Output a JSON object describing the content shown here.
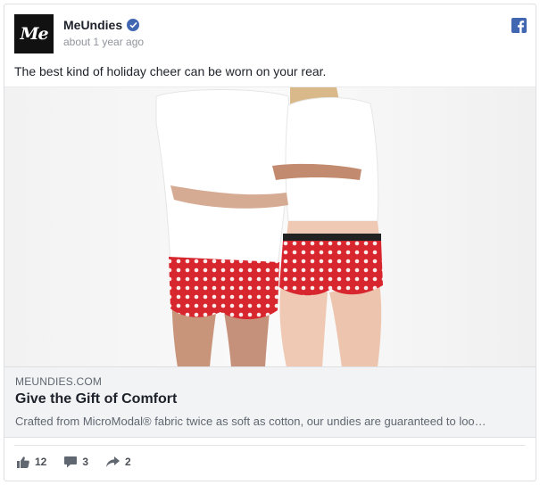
{
  "post": {
    "page_name": "MeUndies",
    "avatar_text": "Me",
    "timestamp": "about 1 year ago",
    "text": "The best kind of holiday cheer can be worn on your rear."
  },
  "link": {
    "domain": "MEUNDIES.COM",
    "title": "Give the Gift of Comfort",
    "description": "Crafted from MicroModal® fabric twice as soft as cotton, our undies are guaranteed to loo…"
  },
  "stats": {
    "likes": "12",
    "comments": "3",
    "shares": "2"
  },
  "icons": {
    "verified": "verified-badge-icon",
    "facebook": "facebook-icon",
    "like": "like-icon",
    "comment": "comment-icon",
    "share": "share-icon"
  },
  "colors": {
    "brand_blue": "#4267b2",
    "muted_text": "#90949c",
    "link_bg": "#f2f3f5"
  }
}
